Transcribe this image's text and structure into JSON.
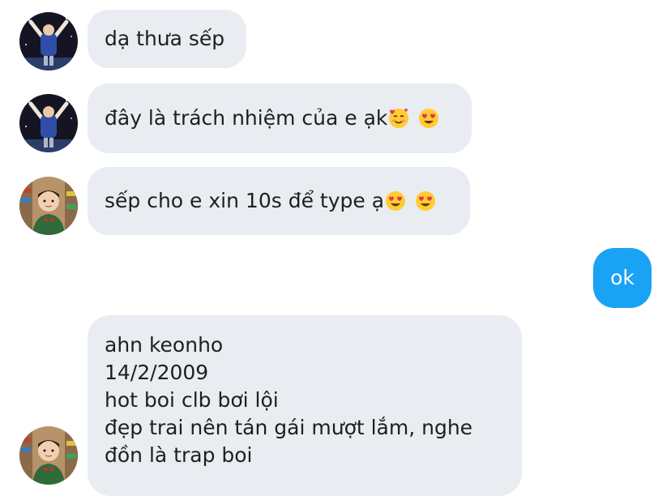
{
  "conversation": {
    "messages": [
      {
        "sender": "contact-1",
        "text": "dạ thưa sếp",
        "emojis": []
      },
      {
        "sender": "contact-1",
        "text": "đây là trách nhiệm của e ạk",
        "emojis": [
          "smiling-face-with-hearts-emoji",
          "heart-eyes-emoji"
        ]
      },
      {
        "sender": "contact-2",
        "text": "sếp cho e xin 10s để type ạ",
        "emojis": [
          "heart-eyes-emoji",
          "heart-eyes-emoji"
        ]
      },
      {
        "sender": "me",
        "text": "ok",
        "emojis": []
      },
      {
        "sender": "contact-2",
        "lines": [
          "ahn keonho",
          "14/2/2009",
          "hot boi clb bơi lội",
          "đẹp trai nên tán gái mượt lắm, nghe",
          "đồn là trap boi"
        ]
      }
    ]
  },
  "colors": {
    "received_bubble": "#e9ecf0",
    "sent_bubble": "#1aa3f5",
    "text": "#1f1f1f"
  }
}
